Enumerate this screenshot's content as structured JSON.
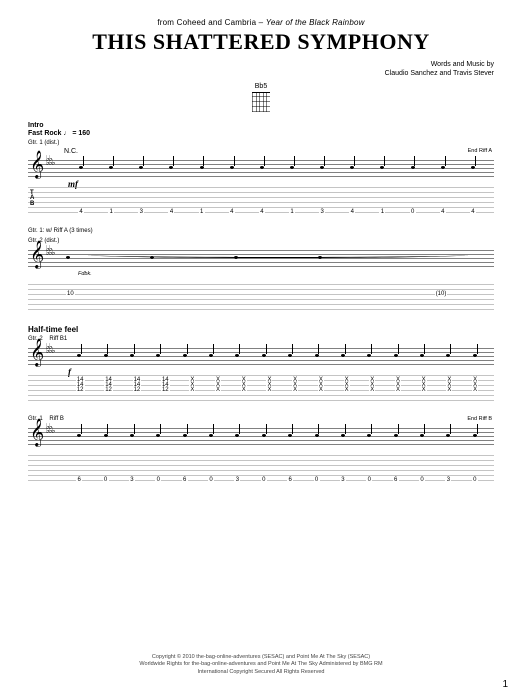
{
  "source_prefix": "from Coheed and Cambria –",
  "album": "Year of the Black Rainbow",
  "title": "THIS SHATTERED SYMPHONY",
  "credits_line1": "Words and Music by",
  "credits_line2": "Claudio Sanchez and Travis Stever",
  "chord": {
    "name": "Bb5"
  },
  "intro": {
    "section": "Intro",
    "tempo": "Fast Rock ♩ = 160",
    "gtr_label": "Gtr. 1 (dist.)",
    "chord_name": "N.C.",
    "dynamic": "mf",
    "end_label": "End Riff A",
    "tab_label": "T\nA\nB",
    "tab_row": [
      "4",
      "1",
      "3",
      "4",
      "1",
      "4",
      "4",
      "1",
      "3",
      "4",
      "1",
      "0",
      "4",
      "4"
    ]
  },
  "system2": {
    "gtr_label": "Gtr. 1: w/ Riff A (3 times)",
    "gtr2_label": "Gtr. 2 (dist.)",
    "technique": "Fdbk.",
    "tab_row": [
      "10",
      "",
      "",
      "",
      "(10)"
    ]
  },
  "halftime": {
    "label": "Half-time feel",
    "gtr2_label": "Gtr. 2",
    "riff_label": "Riff B1",
    "dynamic": "f",
    "tab_row_top": [
      "14",
      "14",
      "14",
      "14",
      "X",
      "X",
      "X",
      "X",
      "X",
      "X",
      "X",
      "X",
      "X",
      "X",
      "X",
      "X"
    ],
    "tab_row_bot": [
      "14",
      "14",
      "14",
      "14",
      "X",
      "X",
      "X",
      "X",
      "X",
      "X",
      "X",
      "X",
      "X",
      "X",
      "X",
      "X"
    ],
    "tab_row_lowest": [
      "12",
      "12",
      "12",
      "12",
      "X",
      "X",
      "X",
      "X",
      "X",
      "X",
      "X",
      "X",
      "X",
      "X",
      "X",
      "X"
    ]
  },
  "system4": {
    "gtr1_label": "Gtr. 1",
    "riff_label": "Riff B",
    "end_label": "End Riff B",
    "tab_row": [
      "6",
      "0",
      "3",
      "0",
      "6",
      "0",
      "3",
      "0",
      "6",
      "0",
      "3",
      "0",
      "6",
      "0",
      "3",
      "0"
    ]
  },
  "copyright": {
    "line1": "Copyright © 2010 the-bag-online-adventures (SESAC) and Point Me At The Sky (SESAC)",
    "line2": "Worldwide Rights for the-bag-online-adventures and Point Me At The Sky Administered by BMG RM",
    "line3": "International Copyright Secured   All Rights Reserved"
  },
  "page_number": "1"
}
